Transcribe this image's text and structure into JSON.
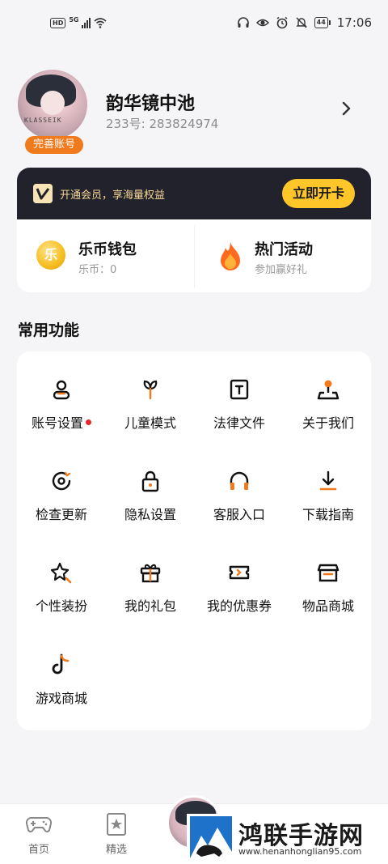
{
  "status_bar": {
    "hd": "HD",
    "network": "5G",
    "battery": "44",
    "time": "17:06"
  },
  "profile": {
    "nickname": "韵华镜中池",
    "uid": "233号: 283824974",
    "complete_badge": "完善账号",
    "avatar_text": "KLASSEIK"
  },
  "vip": {
    "text": "开通会员，享海量权益",
    "button": "立即开卡"
  },
  "wallet": {
    "coin_glyph": "乐",
    "wallet_title": "乐币钱包",
    "wallet_sub": "乐币：0",
    "activity_title": "热门活动",
    "activity_sub": "参加赢好礼"
  },
  "section_title": "常用功能",
  "functions": [
    {
      "label": "账号设置",
      "icon": "user-icon",
      "badge": true
    },
    {
      "label": "儿童模式",
      "icon": "sprout-icon"
    },
    {
      "label": "法律文件",
      "icon": "document-icon"
    },
    {
      "label": "关于我们",
      "icon": "location-pin-icon"
    },
    {
      "label": "检查更新",
      "icon": "refresh-icon"
    },
    {
      "label": "隐私设置",
      "icon": "lock-icon"
    },
    {
      "label": "客服入口",
      "icon": "headset-icon"
    },
    {
      "label": "下载指南",
      "icon": "download-icon"
    },
    {
      "label": "个性装扮",
      "icon": "sparkle-star-icon"
    },
    {
      "label": "我的礼包",
      "icon": "gift-icon"
    },
    {
      "label": "我的优惠券",
      "icon": "ticket-icon"
    },
    {
      "label": "物品商城",
      "icon": "shop-icon"
    },
    {
      "label": "游戏商城",
      "icon": "tiktok-music-icon"
    }
  ],
  "bottom_nav": {
    "home": "首页",
    "featured": "精选"
  },
  "watermark": {
    "title": "鸿联手游网",
    "url": "www.henanhonglian95.com"
  },
  "colors": {
    "accent_orange": "#f07a1c",
    "vip_bg": "#22222c",
    "vip_button": "#ffc629",
    "vip_text": "#f5d795"
  }
}
